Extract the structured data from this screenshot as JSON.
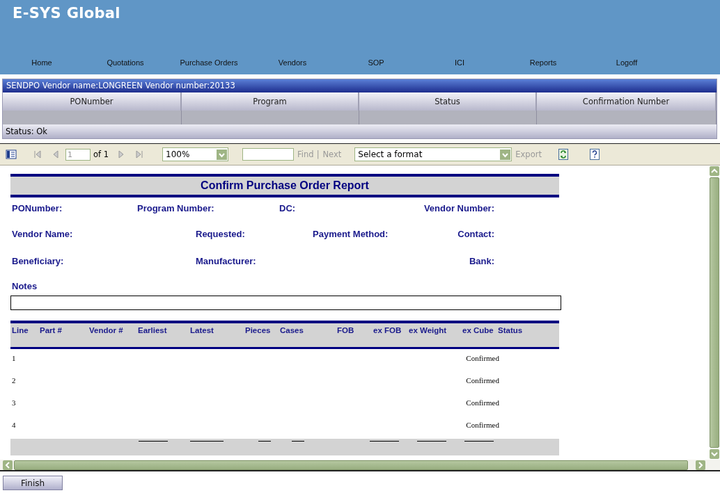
{
  "app": {
    "title": "E-SYS Global"
  },
  "nav": [
    "Home",
    "Quotations",
    "Purchase Orders",
    "Vendors",
    "SOP",
    "ICI",
    "Reports",
    "Logoff"
  ],
  "panel": {
    "title": "SENDPO  Vendor name:LONGREEN Vendor number:20133",
    "columns": [
      "PONumber",
      "Program",
      "Status",
      "Confirmation Number"
    ],
    "status": "Status: Ok"
  },
  "toolbar": {
    "page": "1",
    "page_of": "of 1",
    "zoom": "100%",
    "find": {
      "label": "Find",
      "disabled": true
    },
    "separator": "|",
    "next": {
      "label": "Next",
      "disabled": true
    },
    "format": "Select a format",
    "export": {
      "label": "Export",
      "disabled": true
    }
  },
  "report": {
    "title": "Confirm Purchase Order Report",
    "field_rows": [
      [
        "PONumber:",
        "Program Number:",
        "DC:",
        "Vendor Number:"
      ],
      [
        "Vendor Name:",
        "Requested:",
        "Payment Method:",
        "Contact:"
      ],
      [
        "Beneficiary:",
        "Manufacturer:",
        "Bank:"
      ]
    ],
    "notes_label": "Notes",
    "columns": [
      "Line",
      "Part #",
      "Vendor #",
      "Earliest",
      "Latest",
      "Pieces",
      "Cases",
      "FOB",
      "ex FOB",
      "ex Weight",
      "ex Cube",
      "Status"
    ],
    "rows": [
      {
        "line": "1",
        "status": "Confirmed"
      },
      {
        "line": "2",
        "status": "Confirmed"
      },
      {
        "line": "3",
        "status": "Confirmed"
      },
      {
        "line": "4",
        "status": "Confirmed"
      }
    ]
  },
  "finish": "Finish"
}
